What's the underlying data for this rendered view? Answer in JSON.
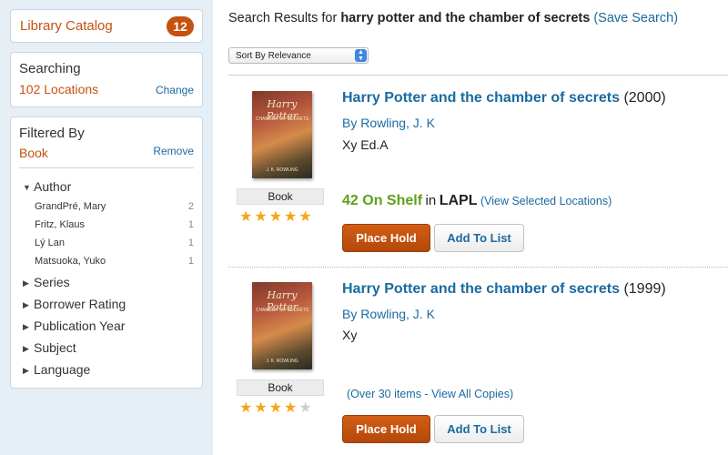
{
  "sidebar": {
    "catalog": {
      "label": "Library Catalog",
      "count": "12"
    },
    "searching": {
      "heading": "Searching",
      "value": "102 Locations",
      "change_label": "Change"
    },
    "filtered": {
      "heading": "Filtered By",
      "value": "Book",
      "remove_label": "Remove",
      "author_group": "Author",
      "authors": [
        {
          "name": "GrandPré, Mary",
          "count": "2"
        },
        {
          "name": "Fritz, Klaus",
          "count": "1"
        },
        {
          "name": "Lý Lan",
          "count": "1"
        },
        {
          "name": "Matsuoka, Yuko",
          "count": "1"
        }
      ],
      "groups": [
        "Series",
        "Borrower Rating",
        "Publication Year",
        "Subject",
        "Language"
      ]
    }
  },
  "header": {
    "prefix": "Search Results for",
    "query": "harry potter and the chamber of secrets",
    "save_search": "Save Search"
  },
  "sort": {
    "selected": "Sort By Relevance"
  },
  "cover_art": {
    "title": "Harry Potter",
    "subtitle": "CHAMBER OF SECRETS",
    "author": "J. K. ROWLING"
  },
  "results": [
    {
      "title": "Harry Potter and the chamber of secrets",
      "year": "(2000)",
      "author": "By Rowling, J. K",
      "edition": "Xy Ed.A",
      "format": "Book",
      "rating": 5,
      "on_shelf": "42 On Shelf",
      "in_word": "in",
      "library": "LAPL",
      "locations_link": "(View Selected Locations)",
      "hold_label": "Place Hold",
      "list_label": "Add To List"
    },
    {
      "title": "Harry Potter and the chamber of secrets",
      "year": "(1999)",
      "author": "By Rowling, J. K",
      "edition": "Xy",
      "format": "Book",
      "rating": 4,
      "copies_link": "(Over 30 items - View All Copies)",
      "hold_label": "Place Hold",
      "list_label": "Add To List"
    }
  ],
  "colors": {
    "accent": "#c5520f",
    "link": "#1a6aa0",
    "on_shelf": "#5ea11b",
    "star": "#f5a516"
  }
}
